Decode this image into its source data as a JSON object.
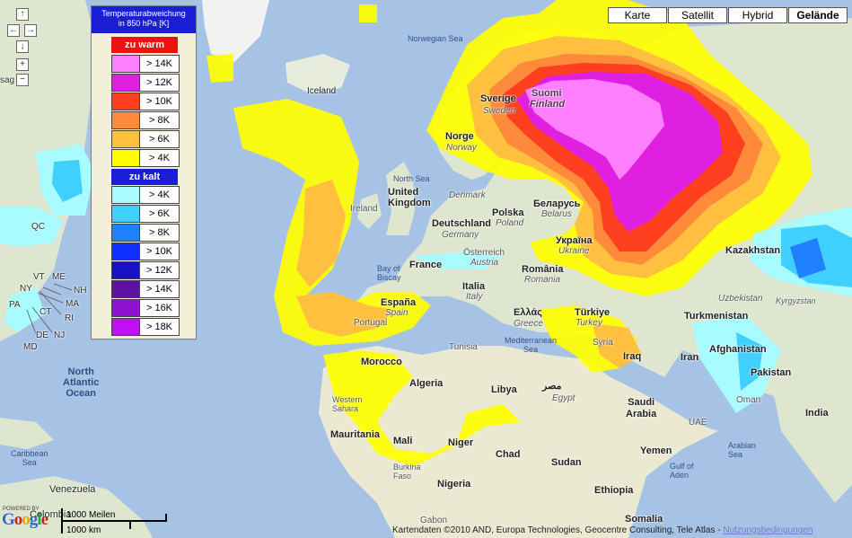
{
  "map_types": [
    "Karte",
    "Satellit",
    "Hybrid",
    "Gelände"
  ],
  "active_map_type": "Gelände",
  "nav": {
    "up": "↑",
    "left": "←",
    "right": "→",
    "down": "↓",
    "zoom_in": "+",
    "zoom_out": "−"
  },
  "legend": {
    "title_line1": "Temperaturabweichung",
    "title_line2": "in 850 hPa [K]",
    "warm_label": "zu warm",
    "warm_color": "#ee1111",
    "warm": [
      {
        "label": "> 14K",
        "color": "#ff80ff"
      },
      {
        "label": "> 12K",
        "color": "#e020e0"
      },
      {
        "label": "> 10K",
        "color": "#ff4020"
      },
      {
        "label": "> 8K",
        "color": "#ff8a3a"
      },
      {
        "label": "> 6K",
        "color": "#ffc040"
      },
      {
        "label": "> 4K",
        "color": "#ffff00"
      }
    ],
    "cold_label": "zu kalt",
    "cold_color": "#1a1fd6",
    "cold": [
      {
        "label": "> 4K",
        "color": "#a8fcff"
      },
      {
        "label": "> 6K",
        "color": "#40d0ff"
      },
      {
        "label": "> 8K",
        "color": "#2080ff"
      },
      {
        "label": "> 10K",
        "color": "#1030ff"
      },
      {
        "label": "> 12K",
        "color": "#1a10c8"
      },
      {
        "label": "> 14K",
        "color": "#6010a0"
      },
      {
        "label": "> 16K",
        "color": "#9010d0"
      },
      {
        "label": "> 18K",
        "color": "#c010f0"
      }
    ]
  },
  "labels": {
    "norwegian_sea": "Norwegian\nSea",
    "iceland": "Iceland",
    "sverige": "Sverige",
    "sweden": "Sweden",
    "suomi": "Suomi",
    "finland": "Finland",
    "norge": "Norge",
    "norway": "Norway",
    "north_sea": "North Sea",
    "united_kingdom": "United\nKingdom",
    "denmark": "Denmark",
    "ireland": "Ireland",
    "polska": "Polska",
    "poland": "Poland",
    "belarus": "Беларусь",
    "belarus_en": "Belarus",
    "deutschland": "Deutschland",
    "germany": "Germany",
    "ukraina": "Україна",
    "ukraine": "Ukraine",
    "osterreich": "Österreich",
    "austria": "Austria",
    "bay_of_biscay": "Bay of\nBiscay",
    "france": "France",
    "romania": "România",
    "romania_en": "Romania",
    "kazakhstan": "Kazakhstan",
    "uzbekistan": "Uzbekistan",
    "kyrgyzstan": "Kyrgyzstan",
    "turkmenistan": "Turkmenistan",
    "espana": "España",
    "spain": "Spain",
    "portugal": "Portugal",
    "italia": "Italia",
    "italy": "Italy",
    "ellas": "Ελλάς",
    "greece": "Greece",
    "turkiye": "Türkiye",
    "turkey": "Turkey",
    "mediterranean": "Mediterranean\nSea",
    "tunisia": "Tunisia",
    "syria": "Syria",
    "iraq": "Iraq",
    "iran": "Iran",
    "afghanistan": "Afghanistan",
    "pakistan": "Pakistan",
    "india": "India",
    "morocco": "Morocco",
    "algeria": "Algeria",
    "libya": "Libya",
    "misr": "مصر",
    "egypt": "Egypt",
    "saudi_arabia": "Saudi\nArabia",
    "oman": "Oman",
    "uae": "UAE",
    "western_sahara": "Western\nSahara",
    "mauritania": "Mauritania",
    "mali": "Mali",
    "niger": "Niger",
    "chad": "Chad",
    "sudan": "Sudan",
    "yemen": "Yemen",
    "gulf_of_aden": "Gulf of\nAden",
    "arabian_sea": "Arabian\nSea",
    "burkina_faso": "Burkina\nFaso",
    "nigeria": "Nigeria",
    "ethiopia": "Ethiopia",
    "somalia": "Somalia",
    "gabon": "Gabon",
    "north_atlantic": "North\nAtlantic\nOcean",
    "caribbean_sea": "Caribbean\nSea",
    "venezuela": "Venezuela",
    "colombia": "Colombia",
    "qc": "QC",
    "vt": "VT",
    "me": "ME",
    "ny": "NY",
    "nh": "NH",
    "pa": "PA",
    "ma": "MA",
    "ct": "CT",
    "ri": "RI",
    "de": "DE",
    "nj": "NJ",
    "md": "MD",
    "sag": "sag"
  },
  "scale": {
    "miles": "1000 Meilen",
    "km": "1000 km"
  },
  "branding": {
    "logo": "Google",
    "powered": "POWERED BY"
  },
  "copyright": "Kartendaten ©2010 AND, Europa Technologies, Geocentre Consulting, Tele Atlas -",
  "terms_link": "Nutzungsbedingungen",
  "colors": {
    "sea": "#a6c3e6",
    "land": "#dfe6cf",
    "desert": "#ece9d2"
  }
}
